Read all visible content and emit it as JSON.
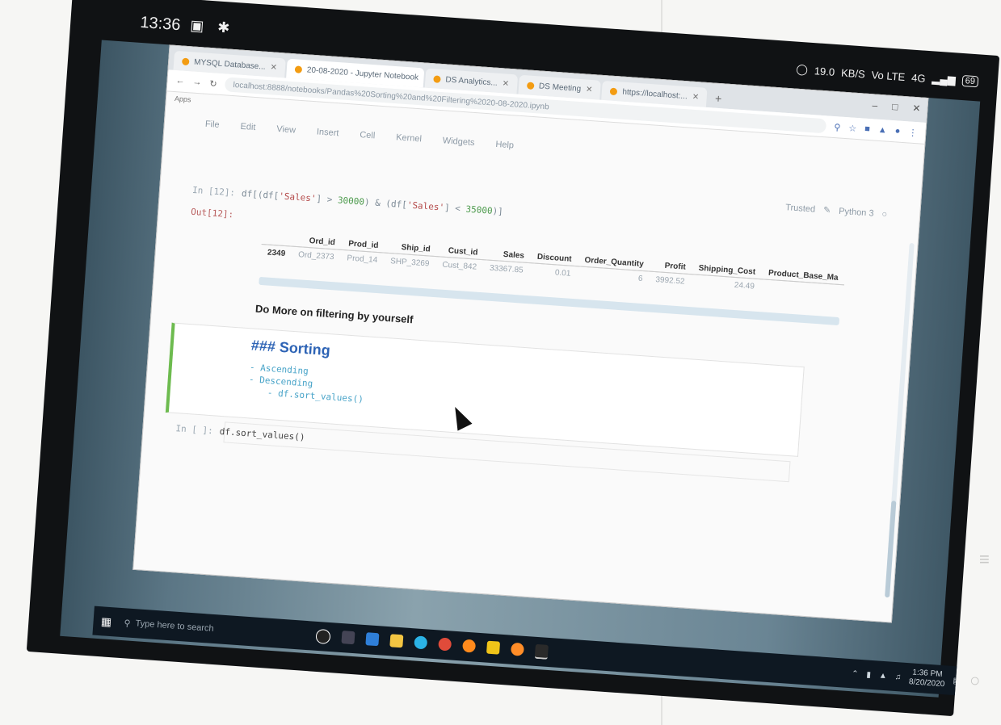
{
  "phone_status": {
    "time": "13:36",
    "left_icons": "▣ ✱",
    "net_speed": "19.0",
    "net_unit": "KB/S",
    "sim": "Vo LTE",
    "signal": "4G",
    "battery": "69"
  },
  "browser": {
    "tabs": [
      {
        "label": "MYSQL Database..."
      },
      {
        "label": "20-08-2020 - Jupyter Notebook",
        "active": true
      },
      {
        "label": "DS Analytics..."
      },
      {
        "label": "DS Meeting"
      },
      {
        "label": "https://localhost:..."
      }
    ],
    "new_tab": "+",
    "window_controls": [
      "–",
      "□",
      "✕"
    ],
    "url": "localhost:8888/notebooks/Pandas%20Sorting%20and%20Filtering%2020-08-2020.ipynb",
    "bookmarks": "Apps"
  },
  "menubar": [
    "File",
    "Edit",
    "View",
    "Insert",
    "Cell",
    "Kernel",
    "Widgets",
    "Help"
  ],
  "kernel": {
    "trusted": "Trusted",
    "name": "Python 3"
  },
  "cell1": {
    "in_prompt": "In [12]:",
    "code_parts": {
      "a": "df[(df[",
      "s1": "'Sales'",
      "b": "] > ",
      "n1": "30000",
      "c": ") & (df[",
      "s2": "'Sales'",
      "d": "] < ",
      "n2": "35000",
      "e": ")]"
    },
    "out_prompt": "Out[12]:"
  },
  "df_table": {
    "columns": [
      "",
      "Ord_id",
      "Prod_id",
      "Ship_id",
      "Cust_id",
      "Sales",
      "Discount",
      "Order_Quantity",
      "Profit",
      "Shipping_Cost",
      "Product_Base_Ma"
    ],
    "rows": [
      [
        "2349",
        "Ord_2373",
        "Prod_14",
        "SHP_3269",
        "Cust_842",
        "33367.85",
        "0.01",
        "6",
        "3992.52",
        "24.49",
        ""
      ]
    ]
  },
  "md_text": "Do More on filtering by yourself",
  "md_cell": {
    "heading": "### Sorting",
    "items": [
      "- Ascending",
      "- Descending",
      "- df.sort_values()"
    ]
  },
  "cell2": {
    "in_prompt": "In [ ]:",
    "code": "df.sort_values()"
  },
  "taskbar": {
    "start_icon": "windows-start-icon",
    "search_placeholder": "Type here to search",
    "tray_time": "1:36 PM",
    "tray_date": "8/20/2020"
  }
}
